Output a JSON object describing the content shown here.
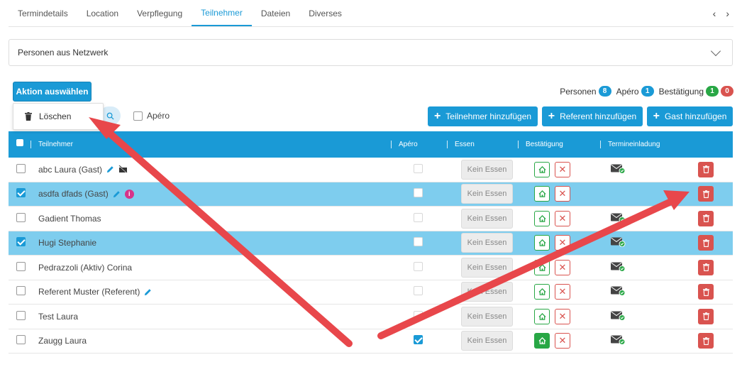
{
  "tabs": [
    {
      "label": "Termindetails"
    },
    {
      "label": "Location"
    },
    {
      "label": "Verpflegung"
    },
    {
      "label": "Teilnehmer"
    },
    {
      "label": "Dateien"
    },
    {
      "label": "Diverses"
    }
  ],
  "tab_nav": {
    "prev": "‹",
    "next": "›"
  },
  "accordion": {
    "title": "Personen aus Netzwerk"
  },
  "action_button": {
    "label": "Aktion auswählen"
  },
  "dropdown": {
    "items": [
      {
        "label": "Löschen",
        "icon": "trash-icon"
      }
    ]
  },
  "apero_filter": {
    "label": "Apéro"
  },
  "counts": {
    "personen_label": "Personen",
    "personen": "8",
    "apero_label": "Apéro",
    "apero": "1",
    "bestaetigung_label": "Bestätigung",
    "bestaetigt": "1",
    "abgelehnt": "0"
  },
  "buttons": {
    "add_teilnehmer": "Teilnehmer hinzufügen",
    "add_referent": "Referent hinzufügen",
    "add_gast": "Gast hinzufügen"
  },
  "table": {
    "headers": {
      "teilnehmer": "Teilnehmer",
      "apero": "Apéro",
      "essen": "Essen",
      "bestaetigung": "Bestätigung",
      "termineinladung": "Termineinladung"
    },
    "essen_label": "Kein Essen",
    "rows": [
      {
        "name": "abc Laura (Gast)",
        "selected": false,
        "apero": false,
        "confirmed": false,
        "invite": true
      },
      {
        "name": "asdfa dfads (Gast)",
        "selected": true,
        "apero": false,
        "confirmed": false,
        "invite": false
      },
      {
        "name": "Gadient Thomas",
        "selected": false,
        "apero": false,
        "confirmed": false,
        "invite": true
      },
      {
        "name": "Hugi Stephanie",
        "selected": true,
        "apero": false,
        "confirmed": false,
        "invite": true
      },
      {
        "name": "Pedrazzoli (Aktiv) Corina",
        "selected": false,
        "apero": false,
        "confirmed": false,
        "invite": true
      },
      {
        "name": "Referent Muster (Referent)",
        "selected": false,
        "apero": false,
        "confirmed": false,
        "invite": true
      },
      {
        "name": "Test Laura",
        "selected": false,
        "apero": false,
        "confirmed": false,
        "invite": true
      },
      {
        "name": "Zaugg Laura",
        "selected": false,
        "apero": true,
        "confirmed": true,
        "invite": true
      }
    ]
  },
  "colors": {
    "accent": "#1a9ad6",
    "selected_row": "#7ecdee",
    "success": "#28a745",
    "danger": "#d9534f",
    "annotation_arrow": "#e8474b"
  }
}
